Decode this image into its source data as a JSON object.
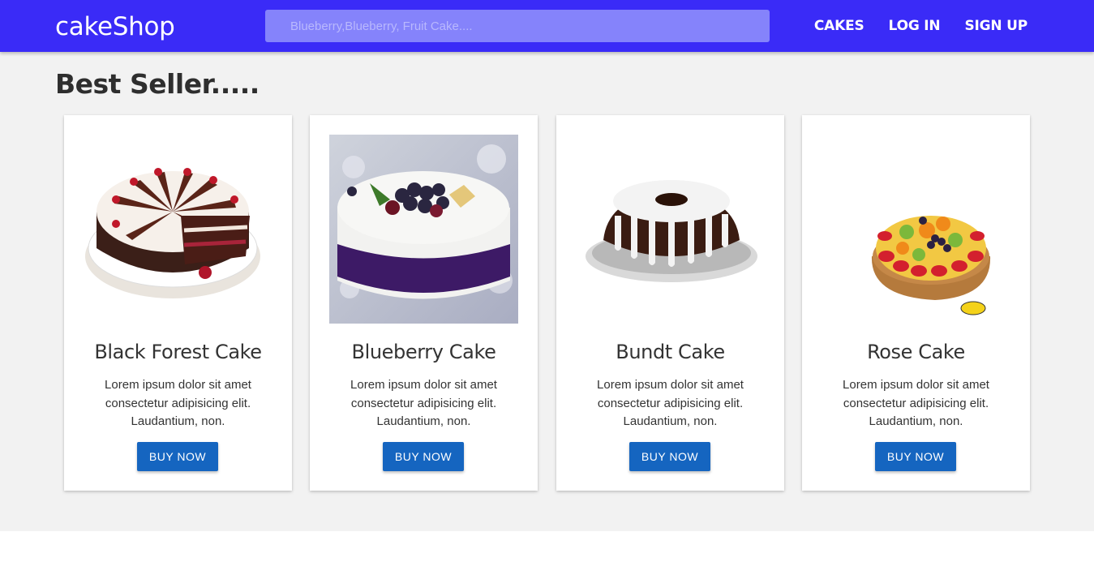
{
  "header": {
    "brand": "cakeShop",
    "search_placeholder": "Blueberry,Blueberry, Fruit Cake....",
    "nav": [
      "CAKES",
      "LOG IN",
      "SIGN UP"
    ]
  },
  "main": {
    "section_title": "Best Seller.....",
    "cards": [
      {
        "title": "Black Forest Cake",
        "description": "Lorem ipsum dolor sit amet consectetur adipisicing elit. Laudantium, non.",
        "button": "BUY NOW",
        "image_icon": "black-forest-cake-image"
      },
      {
        "title": "Blueberry Cake",
        "description": "Lorem ipsum dolor sit amet consectetur adipisicing elit. Laudantium, non.",
        "button": "BUY NOW",
        "image_icon": "blueberry-cake-image"
      },
      {
        "title": "Bundt Cake",
        "description": "Lorem ipsum dolor sit amet consectetur adipisicing elit. Laudantium, non.",
        "button": "BUY NOW",
        "image_icon": "bundt-cake-image"
      },
      {
        "title": "Rose Cake",
        "description": "Lorem ipsum dolor sit amet consectetur adipisicing elit. Laudantium, non.",
        "button": "BUY NOW",
        "image_icon": "fruit-tart-cake-image"
      }
    ]
  },
  "colors": {
    "navbar": "#3a2bf7",
    "search_bg": "#8583fb",
    "button": "#1565c0",
    "page_bg": "#f2f2f2"
  }
}
